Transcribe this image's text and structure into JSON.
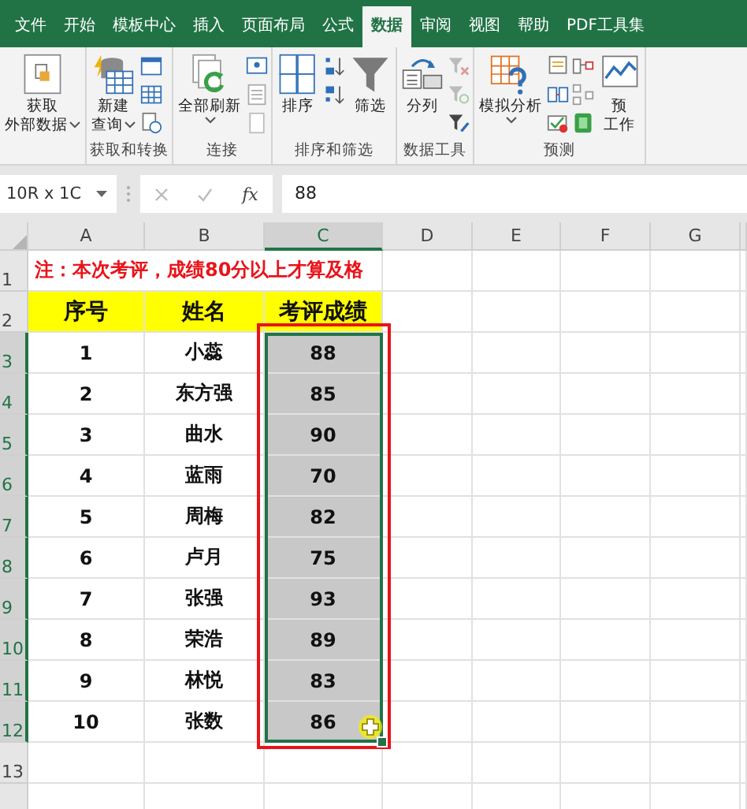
{
  "ribbon": {
    "tabs": [
      {
        "label": "文件",
        "selected": false
      },
      {
        "label": "开始",
        "selected": false
      },
      {
        "label": "模板中心",
        "selected": false
      },
      {
        "label": "插入",
        "selected": false
      },
      {
        "label": "页面布局",
        "selected": false
      },
      {
        "label": "公式",
        "selected": false
      },
      {
        "label": "数据",
        "selected": true
      },
      {
        "label": "审阅",
        "selected": false
      },
      {
        "label": "视图",
        "selected": false
      },
      {
        "label": "帮助",
        "selected": false
      },
      {
        "label": "PDF工具集",
        "selected": false
      }
    ],
    "groups": [
      {
        "buttons": [
          {
            "lines": [
              "获取",
              "外部数据"
            ],
            "dropdown": true
          }
        ]
      },
      {
        "label": "获取和转换",
        "buttons": [
          {
            "lines": [
              "新建",
              "查询"
            ],
            "dropdown": true
          }
        ]
      },
      {
        "label": "连接",
        "buttons": [
          {
            "lines": [
              "全部刷新"
            ],
            "dropdown": true
          }
        ]
      },
      {
        "label": "排序和筛选",
        "buttons": [
          {
            "lines": [
              "排序"
            ],
            "dropdown": false
          },
          {
            "lines": [
              "筛选"
            ],
            "dropdown": false
          }
        ]
      },
      {
        "label": "数据工具",
        "buttons": [
          {
            "lines": [
              "分列"
            ],
            "dropdown": false
          }
        ]
      },
      {
        "label": "预测",
        "buttons": [
          {
            "lines": [
              "模拟分析"
            ],
            "dropdown": true
          },
          {
            "lines": [
              "预",
              "工作"
            ],
            "dropdown": false
          }
        ]
      }
    ]
  },
  "formula_bar": {
    "name_box": "10R x 1C",
    "function_label": "fx",
    "value": "88"
  },
  "sheet": {
    "columns": [
      {
        "label": "A",
        "selected": false
      },
      {
        "label": "B",
        "selected": false
      },
      {
        "label": "C",
        "selected": true
      },
      {
        "label": "D",
        "selected": false
      },
      {
        "label": "E",
        "selected": false
      },
      {
        "label": "F",
        "selected": false
      },
      {
        "label": "G",
        "selected": false
      }
    ],
    "rows": [
      {
        "label": "1",
        "kind": "note",
        "selected": false,
        "cells": [
          "注：本次考评，成绩80分以上才算及格"
        ]
      },
      {
        "label": "2",
        "kind": "header",
        "selected": false,
        "cells": [
          "序号",
          "姓名",
          "考评成绩"
        ]
      },
      {
        "label": "3",
        "kind": "data",
        "selected": true,
        "cells": [
          "1",
          "小蕊",
          "88"
        ]
      },
      {
        "label": "4",
        "kind": "data",
        "selected": true,
        "cells": [
          "2",
          "东方强",
          "85"
        ]
      },
      {
        "label": "5",
        "kind": "data",
        "selected": true,
        "cells": [
          "3",
          "曲水",
          "90"
        ]
      },
      {
        "label": "6",
        "kind": "data",
        "selected": true,
        "cells": [
          "4",
          "蓝雨",
          "70"
        ]
      },
      {
        "label": "7",
        "kind": "data",
        "selected": true,
        "cells": [
          "5",
          "周梅",
          "82"
        ]
      },
      {
        "label": "8",
        "kind": "data",
        "selected": true,
        "cells": [
          "6",
          "卢月",
          "75"
        ]
      },
      {
        "label": "9",
        "kind": "data",
        "selected": true,
        "cells": [
          "7",
          "张强",
          "93"
        ]
      },
      {
        "label": "10",
        "kind": "data",
        "selected": true,
        "cells": [
          "8",
          "荣浩",
          "89"
        ]
      },
      {
        "label": "11",
        "kind": "data",
        "selected": true,
        "cells": [
          "9",
          "林悦",
          "83"
        ]
      },
      {
        "label": "12",
        "kind": "data",
        "selected": true,
        "cells": [
          "10",
          "张数",
          "86"
        ]
      },
      {
        "label": "13",
        "kind": "empty",
        "selected": false,
        "cells": []
      }
    ]
  }
}
